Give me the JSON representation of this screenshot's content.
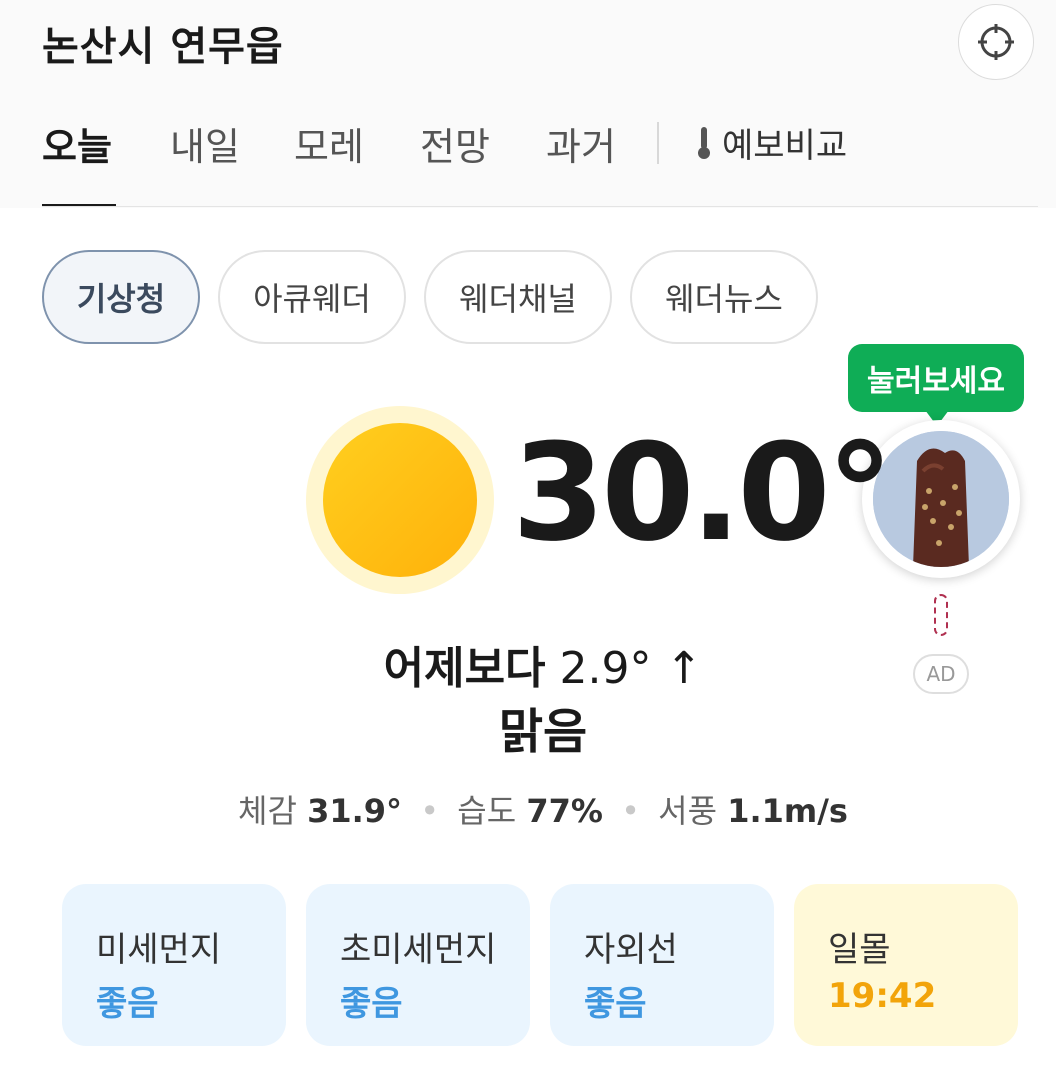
{
  "header": {
    "location": "논산시 연무읍",
    "locate_icon": "crosshair-icon"
  },
  "tabs": {
    "items": [
      "오늘",
      "내일",
      "모레",
      "전망",
      "과거"
    ],
    "active": "오늘",
    "compare_label": "예보비교",
    "compare_icon": "thermometer-icon"
  },
  "providers": {
    "items": [
      "기상청",
      "아큐웨더",
      "웨더채널",
      "웨더뉴스"
    ],
    "active": "기상청"
  },
  "current": {
    "temperature": "30.0°",
    "weather_icon": "sun-icon",
    "compare_prefix": "어제보다",
    "compare_value": "2.9°",
    "compare_arrow": "↑",
    "condition": "맑음",
    "feels_label": "체감",
    "feels_value": "31.9°",
    "humidity_label": "습도",
    "humidity_value": "77%",
    "wind_label": "서풍",
    "wind_value": "1.1m/s"
  },
  "ad": {
    "tooltip": "눌러보세요",
    "badge": "AD",
    "image_icon": "ice-cream-bar-icon"
  },
  "cards": [
    {
      "label": "미세먼지",
      "value": "좋음"
    },
    {
      "label": "초미세먼지",
      "value": "좋음"
    },
    {
      "label": "자외선",
      "value": "좋음"
    },
    {
      "label": "일몰",
      "value": "19:42"
    }
  ],
  "colors": {
    "good": "#3f97e0",
    "sunset": "#f2a40a",
    "tooltip": "#0fad56",
    "sun": "#ffb10a"
  }
}
